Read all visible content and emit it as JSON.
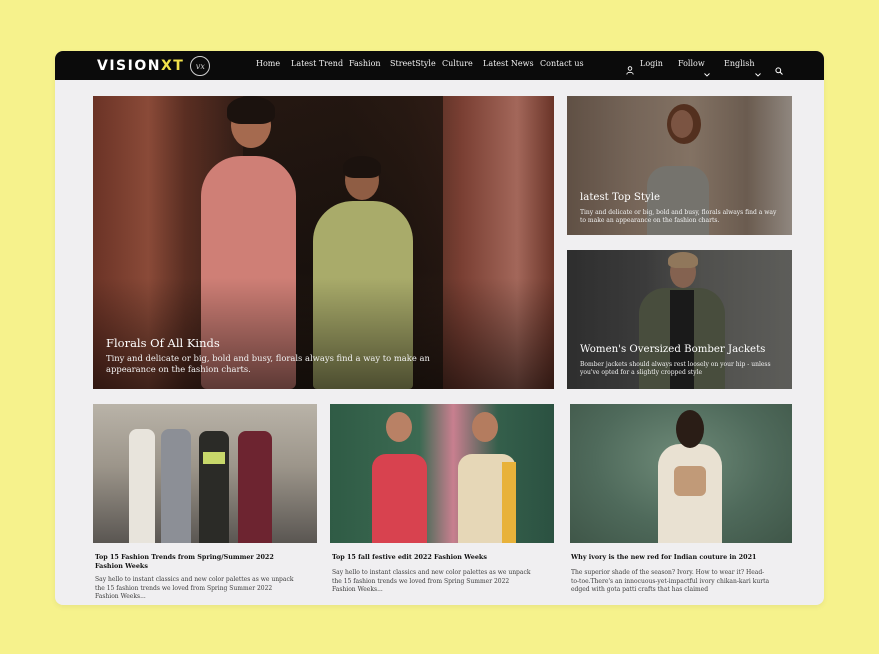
{
  "brand": {
    "logo_main": "VISION",
    "logo_accent": "XT",
    "emblem": "vx"
  },
  "nav": {
    "links": [
      "Home",
      "Latest Trend",
      "Fashion",
      "StreetStyle",
      "Culture",
      "Latest News",
      "Contact us"
    ],
    "login": "Login",
    "follow": "Follow",
    "language": "English"
  },
  "hero": {
    "main": {
      "title": "Florals Of All Kinds",
      "description": "Tiny and delicate or big, bold and busy, florals always find a way to make an appearance on the fashion charts."
    },
    "side_top": {
      "title": "latest Top Style",
      "description": "Tiny and delicate or big, bold and busy, florals always find a way to make an appearance on the fashion charts."
    },
    "side_bottom": {
      "title": "Women's Oversized Bomber Jackets",
      "description": "Bomber jackets should always rest loosely on your hip - unless you've opted for a slightly cropped style"
    }
  },
  "articles": [
    {
      "title": "Top 15 Fashion Trends from Spring/Summer 2022 Fashion Weeks",
      "description": "Say hello to instant classics and new color palettes as we unpack the 15 fashion trends we loved from Spring Summer 2022 Fashion Weeks..."
    },
    {
      "title": "Top 15 fall festive edit 2022 Fashion Weeks",
      "description": "Say hello to instant classics and new color palettes as we unpack the 15 fashion trends we loved from Spring Summer 2022 Fashion Weeks..."
    },
    {
      "title": "Why ivory is the new red for Indian couture in 2021",
      "description": "The superior shade of the season? Ivory. How to wear it? Head-to-toe.There's an innocuous-yet-impactful ivory chikan-kari kurta edged with gota patti crafts that has claimed"
    }
  ],
  "colors": {
    "page_background": "#f6f28c",
    "nav_background": "#0b0b0b",
    "logo_accent": "#f2e24a",
    "content_background": "#f0eff1"
  },
  "icons": [
    "user-icon",
    "chevron-down-icon",
    "search-icon"
  ]
}
